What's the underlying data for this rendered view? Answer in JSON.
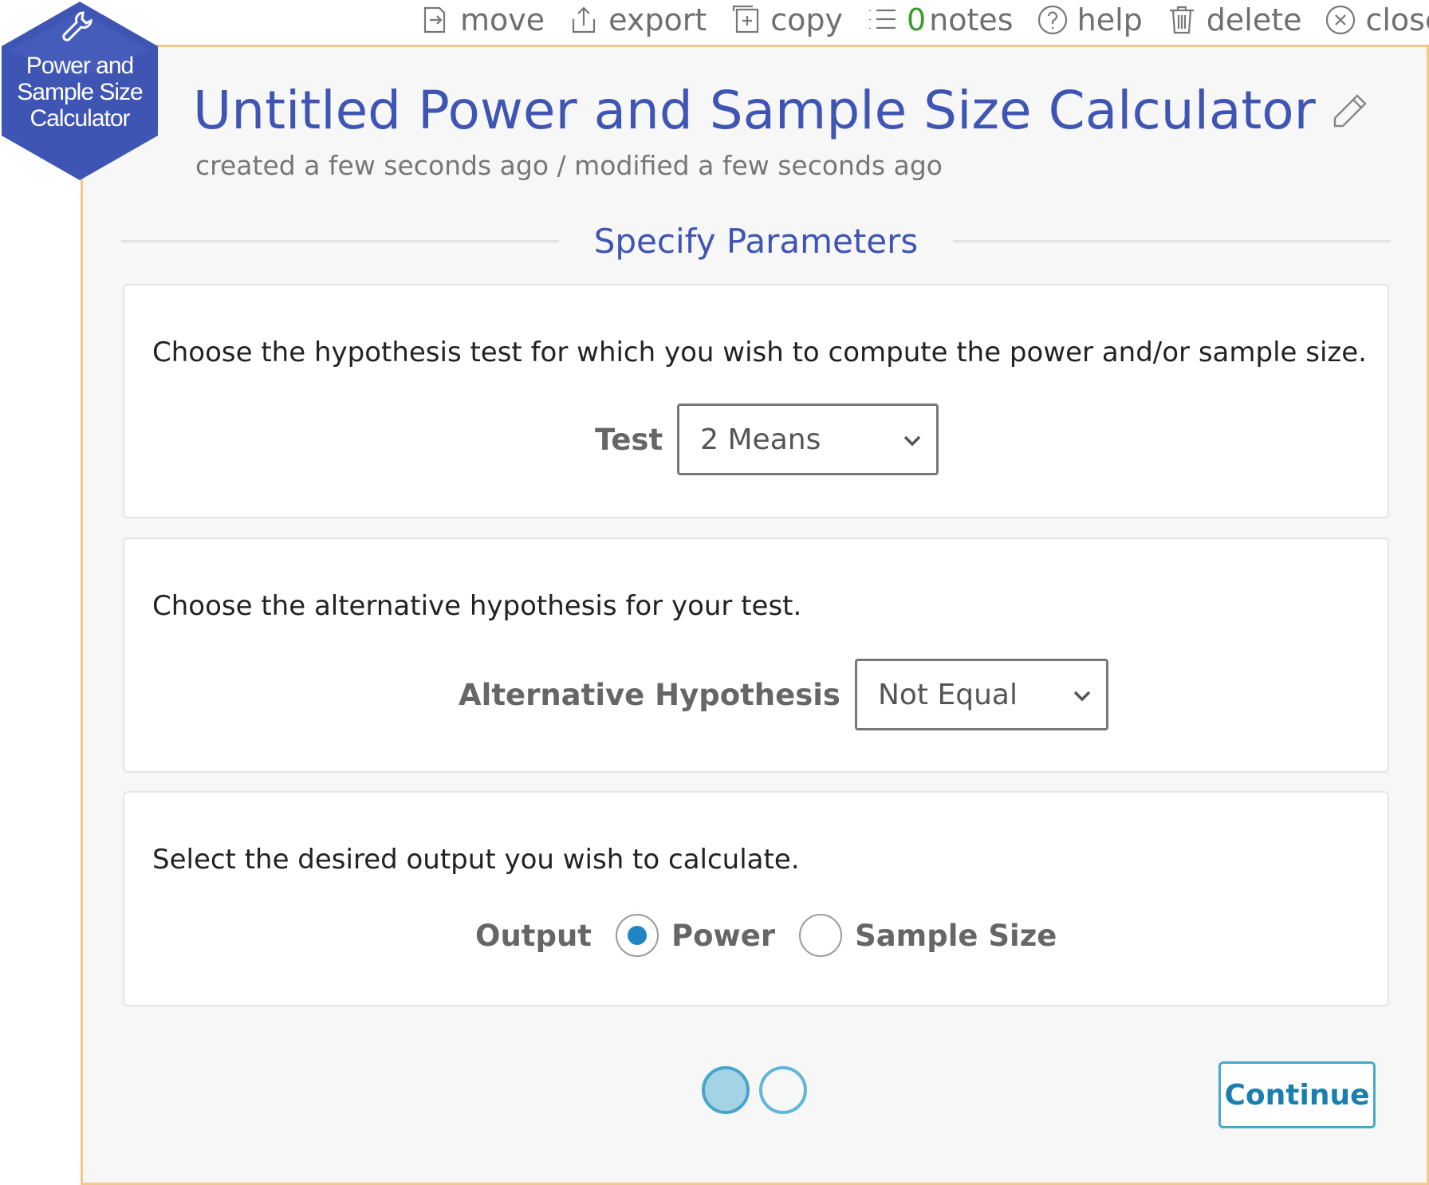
{
  "toolbar": {
    "move": "move",
    "export": "export",
    "copy": "copy",
    "notes_count": "0",
    "notes": "notes",
    "help": "help",
    "delete": "delete",
    "close": "close"
  },
  "badge": {
    "line1": "Power and",
    "line2": "Sample Size",
    "line3": "Calculator",
    "color": "#3f55b4",
    "icon": "wrench-icon"
  },
  "header": {
    "title": "Untitled Power and Sample Size Calculator",
    "meta": "created a few seconds ago / modified a few seconds ago"
  },
  "section": {
    "title": "Specify Parameters"
  },
  "test_card": {
    "description": "Choose the hypothesis test for which you wish to compute the power and/or sample size.",
    "label": "Test",
    "selected": "2 Means"
  },
  "alt_card": {
    "description": "Choose the alternative hypothesis for your test.",
    "label": "Alternative Hypothesis",
    "selected": "Not Equal"
  },
  "output_card": {
    "description": "Select the desired output you wish to calculate.",
    "label": "Output",
    "options": [
      {
        "label": "Power",
        "checked": true
      },
      {
        "label": "Sample Size",
        "checked": false
      }
    ]
  },
  "footer": {
    "continue": "Continue",
    "pages": 2,
    "current_page": 1
  },
  "colors": {
    "accent": "#3f55b4",
    "panel_border": "#f3c98a",
    "button": "#1a7fae",
    "notes_count": "#3d9a2c"
  }
}
